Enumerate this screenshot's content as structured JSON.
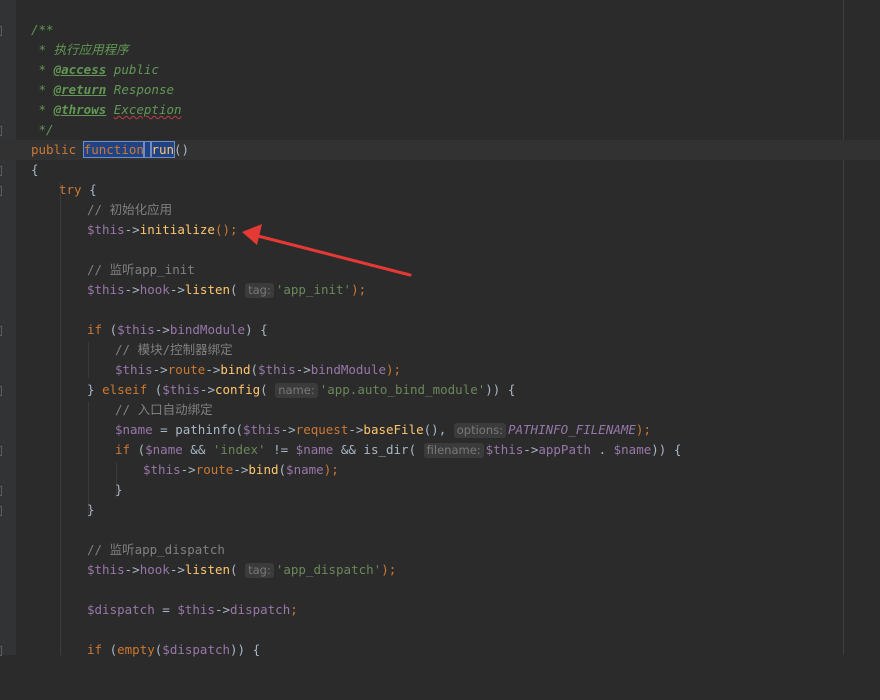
{
  "colors": {
    "background": "#2b2b2b",
    "keyword": "#cc7832",
    "variable": "#9876aa",
    "function": "#ffc66d",
    "string": "#6a8759",
    "comment": "#808080",
    "doc_comment": "#629755",
    "selection": "#214283",
    "annotation_arrow": "#e53935"
  },
  "annotation": {
    "type": "arrow",
    "points_to": "initialize-call",
    "icon": "red-arrow"
  },
  "code": {
    "doc_open": "/**",
    "doc_desc_star": " * ",
    "doc_desc": "执行应用程序",
    "doc_star": " * ",
    "tag_access": "@access",
    "val_access": " public",
    "tag_return": "@return",
    "val_return": " Response",
    "tag_throws": "@throws",
    "val_throws": "Exception",
    "doc_close": " */",
    "kw_public": "public",
    "kw_function": "function",
    "fn_run": "run",
    "parens": "()",
    "brace_open": "{",
    "brace_close": "}",
    "kw_try": "try",
    "cmt_init": "// 初始化应用",
    "var_this": "$this",
    "arrow_op": "->",
    "fn_initialize": "initialize",
    "call_end": "();",
    "cmt_app_init": "// 监听app_init",
    "fn_hook": "hook",
    "fn_listen": "listen",
    "hint_tag": "tag:",
    "str_app_init": "'app_init'",
    "close_call": ");",
    "kw_if": "if",
    "prop_bindModule": "bindModule",
    "cmt_bind": "// 模块/控制器绑定",
    "prop_route": "route",
    "fn_bind": "bind",
    "kw_elseif": "elseif",
    "fn_config": "config",
    "hint_name": "name:",
    "str_auto_bind": "'app.auto_bind_module'",
    "cmt_entry": "// 入口自动绑定",
    "var_name": "$name",
    "fn_pathinfo": "pathinfo",
    "prop_request": "request",
    "fn_baseFile": "baseFile",
    "hint_options": "options:",
    "const_pathinfo": "PATHINFO_FILENAME",
    "str_index": "'index'",
    "fn_is_dir": "is_dir",
    "hint_filename": "filename:",
    "prop_appPath": "appPath",
    "cmt_dispatch": "// 监听app_dispatch",
    "str_app_dispatch": "'app_dispatch'",
    "var_dispatch": "$dispatch",
    "prop_dispatch": "dispatch",
    "fn_empty": "empty"
  }
}
